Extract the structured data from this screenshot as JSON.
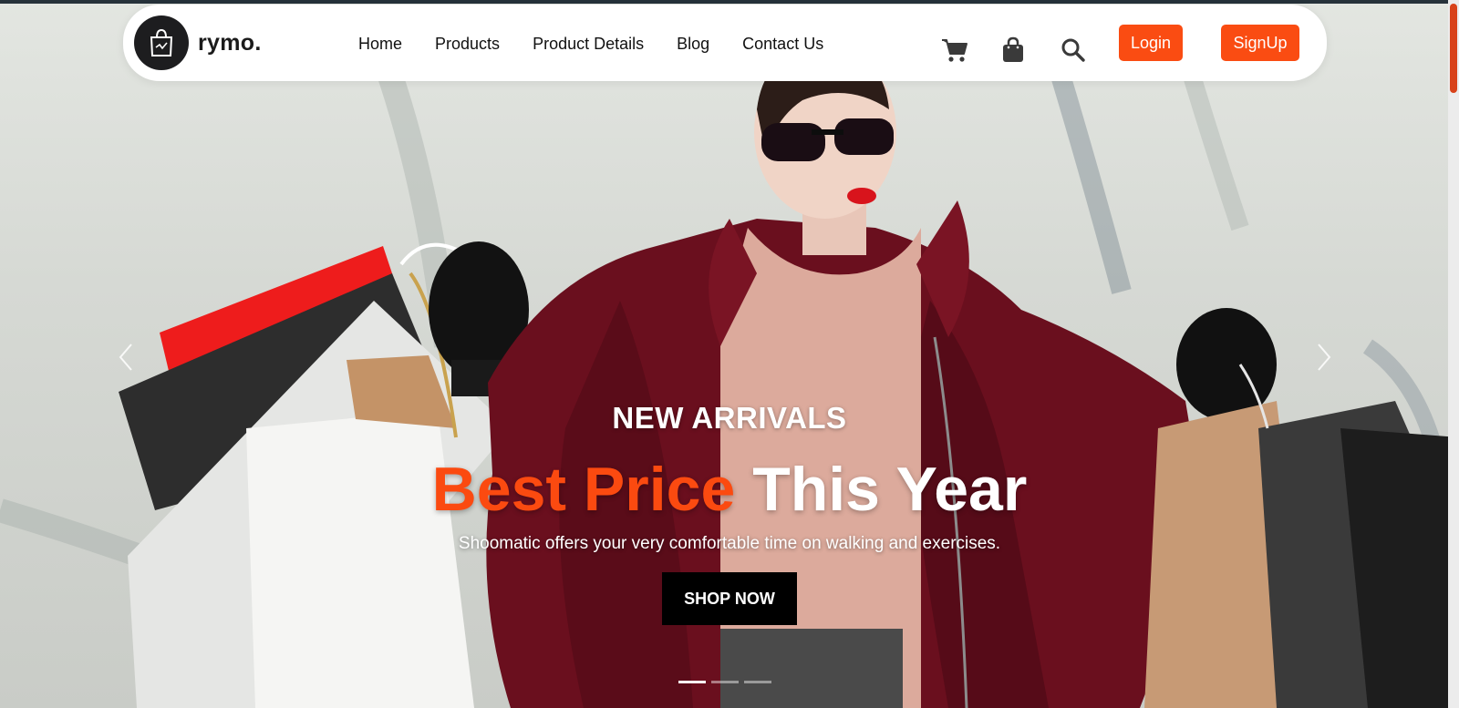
{
  "brand": {
    "name": "rymo.",
    "logo_icon": "shopping-bag-logo-icon"
  },
  "nav": {
    "links": [
      "Home",
      "Products",
      "Product Details",
      "Blog",
      "Contact Us"
    ],
    "icons": [
      "cart-icon",
      "bag-icon",
      "search-icon"
    ],
    "login_label": "Login",
    "signup_label": "SignUp"
  },
  "hero": {
    "eyebrow": "NEW ARRIVALS",
    "headline_accent": "Best Price",
    "headline_rest": "This Year",
    "subtitle": "Shoomatic offers your very comfortable time on walking and exercises.",
    "cta_label": "SHOP NOW",
    "slide_count": 3,
    "active_slide": 1
  },
  "colors": {
    "accent": "#fa4c12",
    "dark": "#000000",
    "navbar_bg": "#ffffff"
  }
}
